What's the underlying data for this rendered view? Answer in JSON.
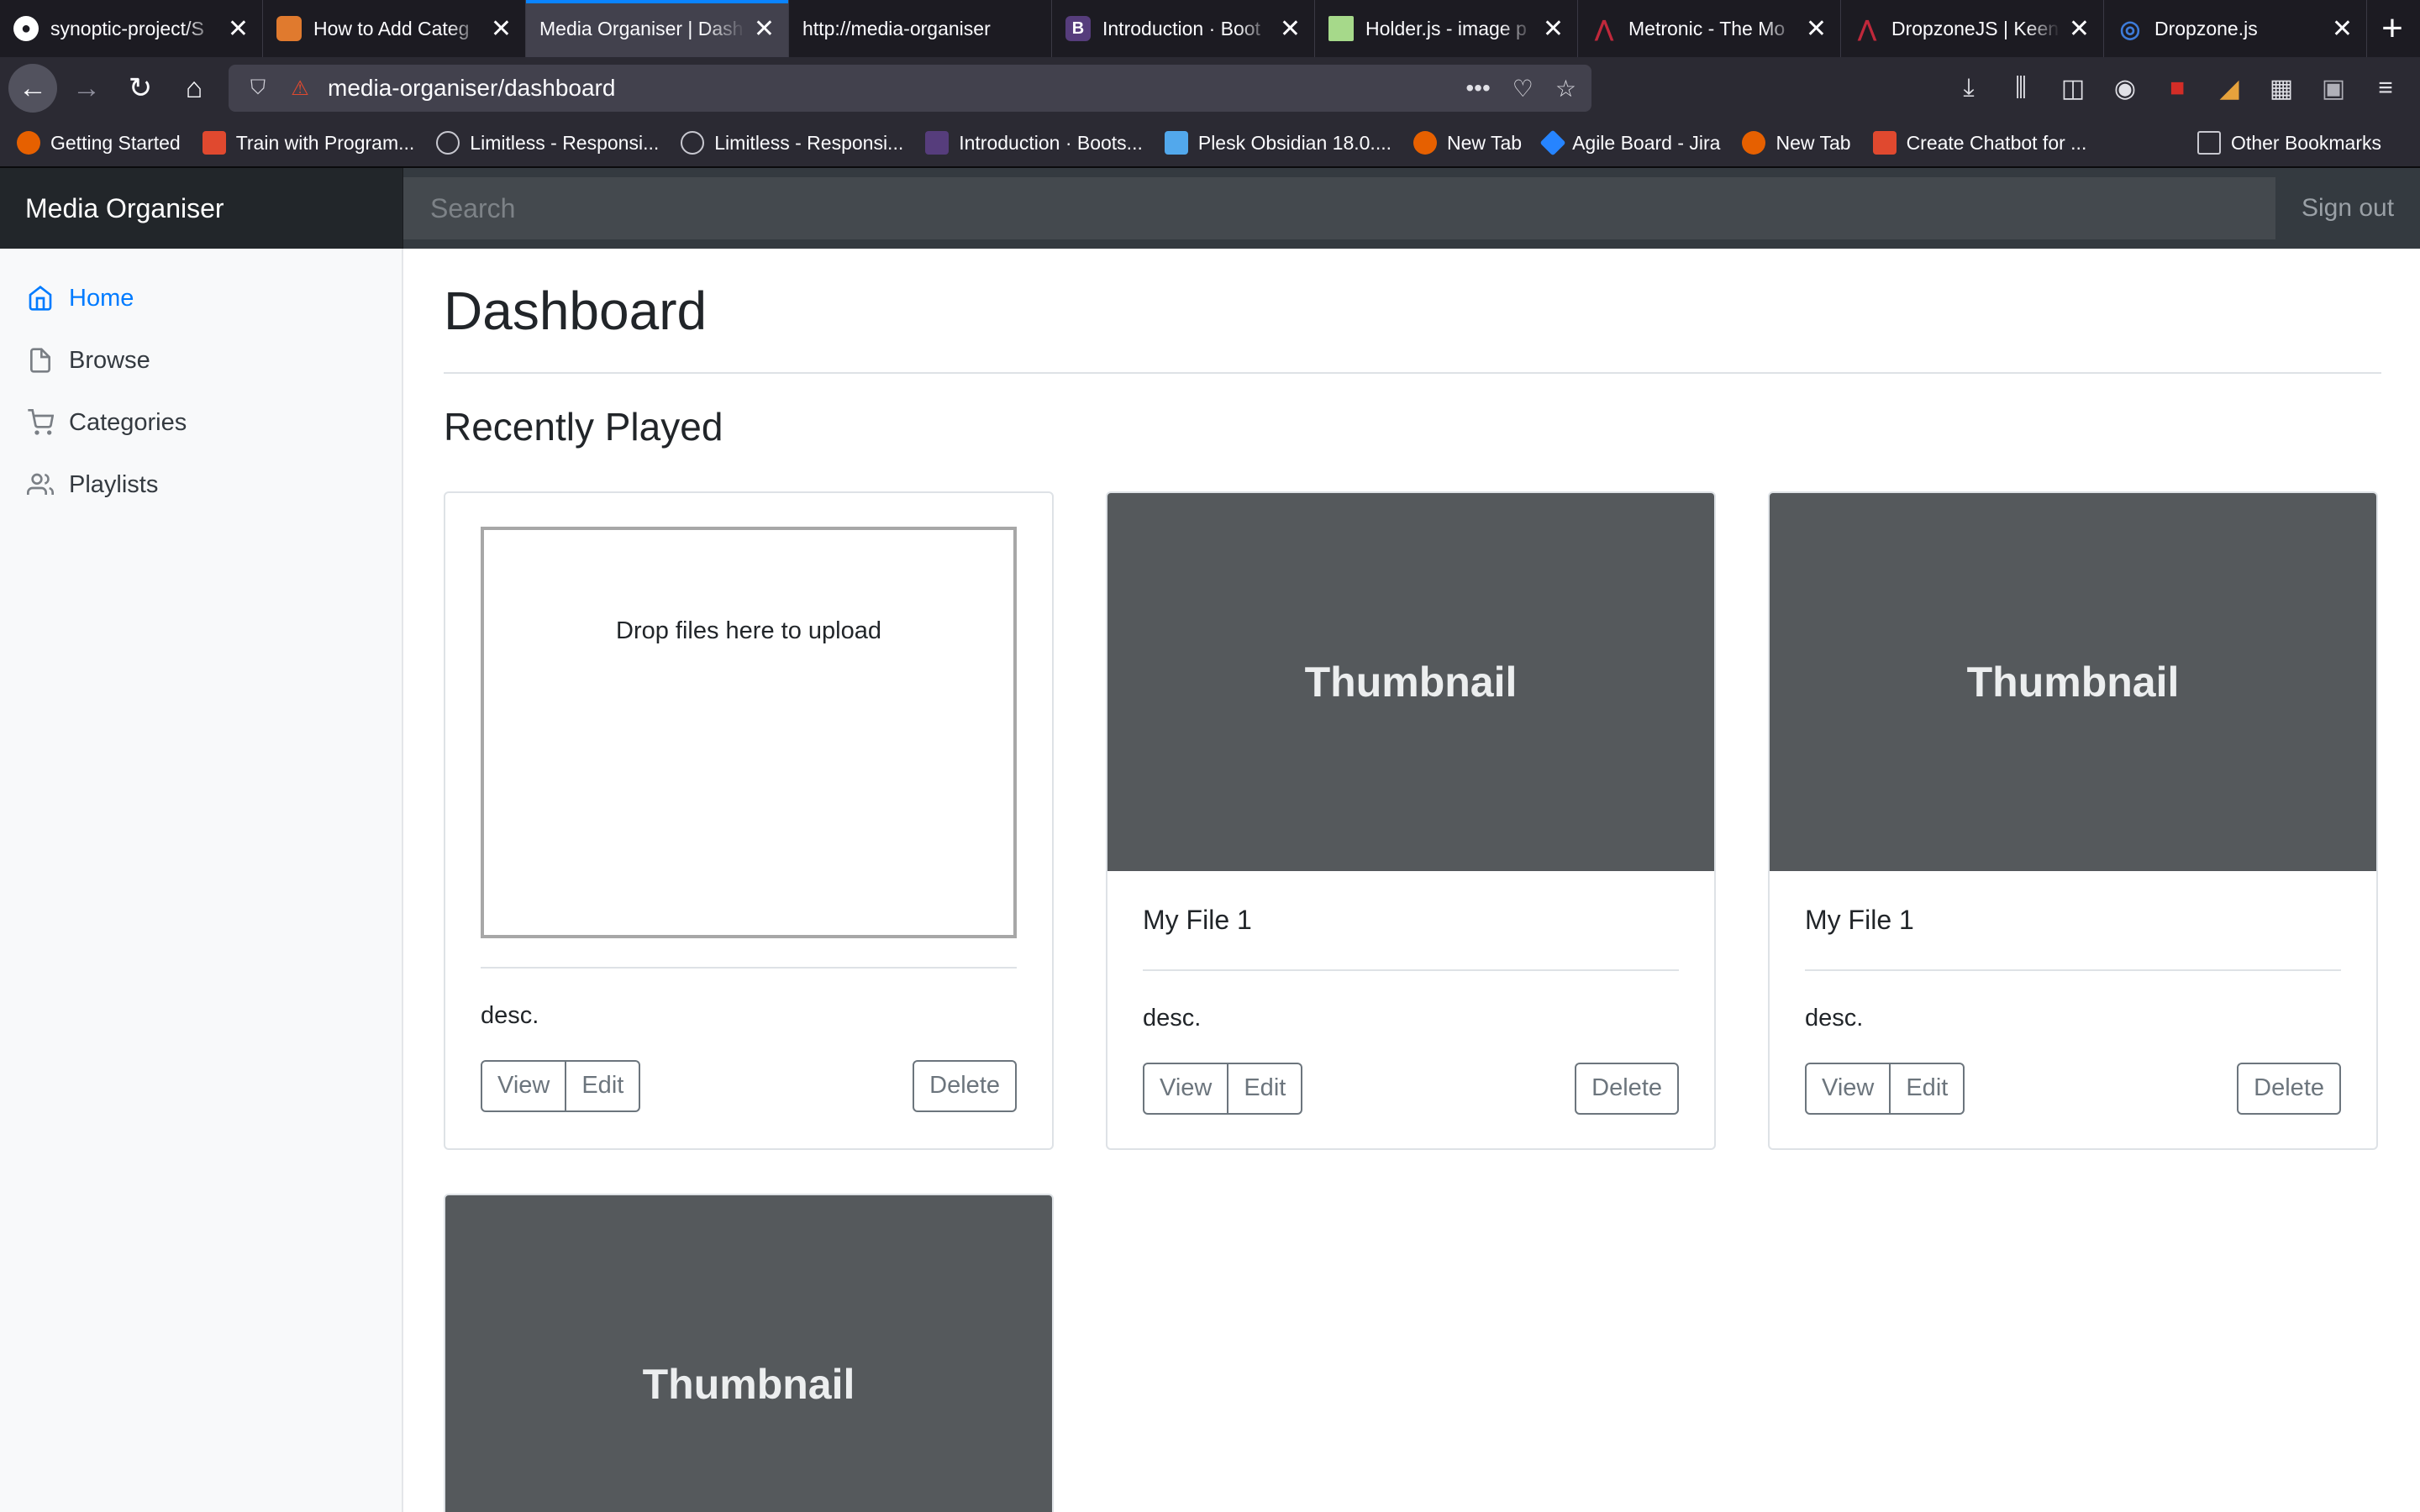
{
  "browser": {
    "tabs": [
      {
        "title": "synoptic-project/S",
        "icon": "github-icon",
        "color": "#1c1b22"
      },
      {
        "title": "How to Add Categ",
        "icon": "stackoverflow-icon",
        "color": "#e07a2e"
      },
      {
        "title": "Media Organiser | Dash",
        "icon": "",
        "color": "",
        "active": true
      },
      {
        "title": "http://media-organiser",
        "icon": "",
        "color": ""
      },
      {
        "title": "Introduction · Boot",
        "icon": "bootstrap-icon",
        "color": "#563d7c"
      },
      {
        "title": "Holder.js - image p",
        "icon": "holder-icon",
        "color": "#a6d98a"
      },
      {
        "title": "Metronic - The Mo",
        "icon": "metronic-icon",
        "color": "#c0283b"
      },
      {
        "title": "DropzoneJS | Keen",
        "icon": "dropzone-keen-icon",
        "color": "#c0283b"
      },
      {
        "title": "Dropzone.js",
        "icon": "dropzone-icon",
        "color": "#3d7bd9"
      }
    ],
    "url": "media-organiser/dashboard",
    "bookmarks": [
      {
        "label": "Getting Started",
        "color": "#e66000"
      },
      {
        "label": "Train with Program...",
        "color": "#e0492f"
      },
      {
        "label": "Limitless - Responsi...",
        "color": "#9a9aa0"
      },
      {
        "label": "Limitless - Responsi...",
        "color": "#9a9aa0"
      },
      {
        "label": "Introduction · Boots...",
        "color": "#563d7c"
      },
      {
        "label": "Plesk Obsidian 18.0....",
        "color": "#52a8ec"
      },
      {
        "label": "New Tab",
        "color": "#e66000"
      },
      {
        "label": "Agile Board - Jira",
        "color": "#2684ff"
      },
      {
        "label": "New Tab",
        "color": "#e66000"
      },
      {
        "label": "Create Chatbot for ...",
        "color": "#e0492f"
      }
    ],
    "other_bookmarks": "Other Bookmarks"
  },
  "app": {
    "brand": "Media Organiser",
    "search_placeholder": "Search",
    "sign_out": "Sign out"
  },
  "sidebar": {
    "items": [
      {
        "label": "Home",
        "icon": "home-icon",
        "active": true
      },
      {
        "label": "Browse",
        "icon": "file-icon"
      },
      {
        "label": "Categories",
        "icon": "cart-icon"
      },
      {
        "label": "Playlists",
        "icon": "users-icon"
      }
    ]
  },
  "main": {
    "title": "Dashboard",
    "section": "Recently Played",
    "dropzone_text": "Drop files here to upload",
    "cards": [
      {
        "type": "dropzone",
        "title": "",
        "desc": "desc.",
        "view": "View",
        "edit": "Edit",
        "delete": "Delete"
      },
      {
        "type": "media",
        "thumb": "Thumbnail",
        "title": "My File 1",
        "desc": "desc.",
        "view": "View",
        "edit": "Edit",
        "delete": "Delete"
      },
      {
        "type": "media",
        "thumb": "Thumbnail",
        "title": "My File 1",
        "desc": "desc.",
        "view": "View",
        "edit": "Edit",
        "delete": "Delete"
      },
      {
        "type": "media",
        "thumb": "Thumbnail",
        "title": "",
        "desc": "",
        "view": "",
        "edit": "",
        "delete": ""
      }
    ]
  }
}
